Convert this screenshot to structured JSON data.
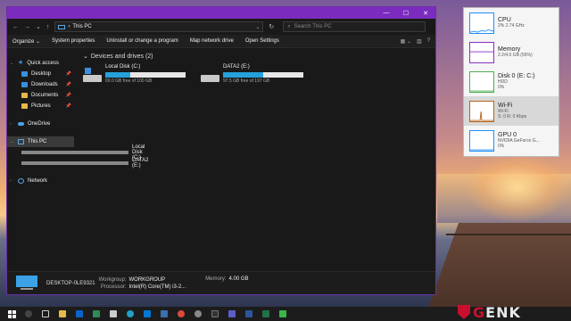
{
  "explorer": {
    "title": "",
    "address": {
      "location": "This PC"
    },
    "search": {
      "placeholder": "Search This PC"
    },
    "commands": [
      "Organize",
      "System properties",
      "Uninstall or change a program",
      "Map network drive",
      "Open Settings"
    ],
    "nav": {
      "quick_access": "Quick access",
      "pinned": [
        "Desktop",
        "Downloads",
        "Documents",
        "Pictures"
      ],
      "onedrive": "OneDrive",
      "this_pc": "This PC",
      "drives": [
        "Local Disk (C:)",
        "DATA2 (E:)"
      ],
      "network": "Network"
    },
    "group_header": "Devices and drives (2)",
    "drives": [
      {
        "name": "Local Disk (C:)",
        "free_text": "69.0 GB free of 100 GB",
        "used_fraction": 0.31,
        "icon": "windows-drive-icon"
      },
      {
        "name": "DATA2 (E:)",
        "free_text": "97.5 GB free of 197 GB",
        "used_fraction": 0.505,
        "icon": "hard-drive-icon"
      }
    ],
    "details": {
      "name": "DESKTOP-0LE9321",
      "workgroup_label": "Workgroup:",
      "workgroup": "WORKGROUP",
      "memory_label": "Memory:",
      "memory": "4.00 GB",
      "processor_label": "Processor:",
      "processor": "Intel(R) Core(TM) i3-2..."
    },
    "accent": "#7b2cbf"
  },
  "taskmgr": {
    "items": [
      {
        "name": "CPU",
        "sub1": "2% 2.74 GHz",
        "sub2": "",
        "color": "#1e90ff"
      },
      {
        "name": "Memory",
        "sub1": "2.2/4.0 GB (55%)",
        "sub2": "",
        "color": "#8b2fbf"
      },
      {
        "name": "Disk 0 (E: C:)",
        "sub1": "HDD",
        "sub2": "0%",
        "color": "#4caf50"
      },
      {
        "name": "Wi-Fi",
        "sub1": "Wi-Fi",
        "sub2": "S: 0 R: 0 Kbps",
        "color": "#b5651d"
      },
      {
        "name": "GPU 0",
        "sub1": "NVIDIA GeForce G...",
        "sub2": "0%",
        "color": "#1e90ff"
      }
    ]
  },
  "watermark": {
    "brand_prefix": "G",
    "brand_suffix": "ENK"
  }
}
